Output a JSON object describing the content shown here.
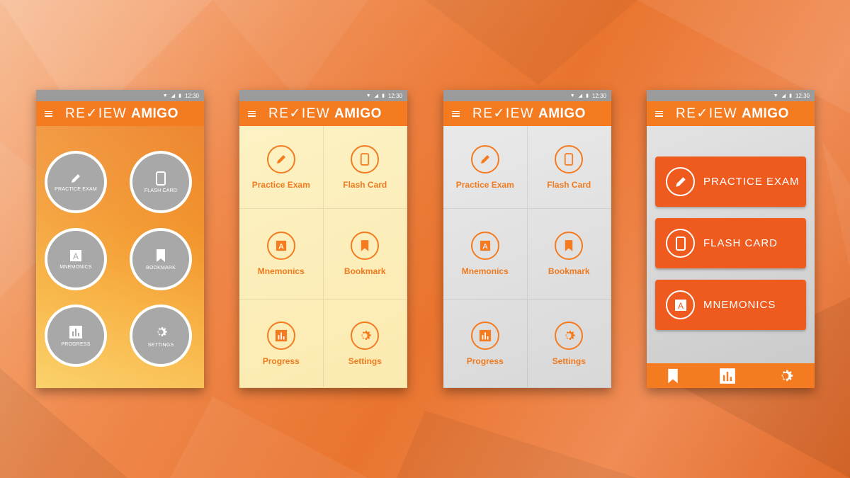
{
  "app": {
    "title_part1": "RE✓IEW",
    "title_part2": "AMIGO"
  },
  "statusbar": {
    "time": "12:30"
  },
  "colors": {
    "accent": "#f47b20",
    "button_gray": "#a8a8a8",
    "bar_orange": "#ef5a1e"
  },
  "phone1": {
    "items": [
      {
        "label": "PRACTICE EXAM",
        "icon": "pencil-icon"
      },
      {
        "label": "FLASH CARD",
        "icon": "card-icon"
      },
      {
        "label": "MNEMONICS",
        "icon": "letter-a-icon"
      },
      {
        "label": "BOOKMARK",
        "icon": "bookmark-icon"
      },
      {
        "label": "PROGRESS",
        "icon": "chart-icon"
      },
      {
        "label": "SETTINGS",
        "icon": "gear-icon"
      }
    ]
  },
  "phone2": {
    "items": [
      {
        "label": "Practice Exam"
      },
      {
        "label": "Flash Card"
      },
      {
        "label": "Mnemonics"
      },
      {
        "label": "Bookmark"
      },
      {
        "label": "Progress"
      },
      {
        "label": "Settings"
      }
    ]
  },
  "phone3": {
    "items": [
      {
        "label": "Practice Exam"
      },
      {
        "label": "Flash Card"
      },
      {
        "label": "Mnemonics"
      },
      {
        "label": "Bookmark"
      },
      {
        "label": "Progress"
      },
      {
        "label": "Settings"
      }
    ]
  },
  "phone4": {
    "items": [
      {
        "label": "PRACTICE EXAM",
        "icon": "pencil-icon"
      },
      {
        "label": "FLASH CARD",
        "icon": "card-icon"
      },
      {
        "label": "MNEMONICS",
        "icon": "letter-a-icon"
      }
    ],
    "bottom_nav": [
      "bookmark-icon",
      "chart-icon",
      "gear-icon"
    ]
  }
}
